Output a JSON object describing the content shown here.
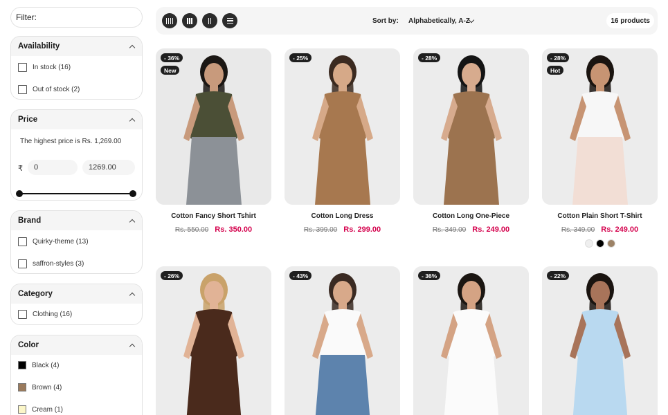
{
  "sidebar": {
    "filter_label": "Filter:",
    "availability": {
      "title": "Availability",
      "options": [
        {
          "label": "In stock (16)"
        },
        {
          "label": "Out of stock (2)"
        }
      ]
    },
    "price": {
      "title": "Price",
      "note": "The highest price is Rs. 1,269.00",
      "currency": "₹",
      "min": "0",
      "max": "1269.00"
    },
    "brand": {
      "title": "Brand",
      "options": [
        {
          "label": "Quirky-theme (13)"
        },
        {
          "label": "saffron-styles (3)"
        }
      ]
    },
    "category": {
      "title": "Category",
      "options": [
        {
          "label": "Clothing (16)"
        }
      ]
    },
    "color": {
      "title": "Color",
      "options": [
        {
          "label": "Black (4)",
          "swatch": "#000000"
        },
        {
          "label": "Brown (4)",
          "swatch": "#9a7a5c"
        },
        {
          "label": "Cream (1)",
          "swatch": "#fbf6c8"
        }
      ]
    }
  },
  "toolbar": {
    "views": [
      "grid-4-icon",
      "grid-3-icon",
      "grid-2-icon",
      "list-icon"
    ],
    "sort_label": "Sort by:",
    "sort_value": "Alphabetically, A-Z",
    "count": "16 products"
  },
  "products": [
    {
      "name": "Cotton Fancy Short Tshirt",
      "old": "Rs. 550.00",
      "new": "Rs. 350.00",
      "badges": [
        "- 36%",
        "New"
      ],
      "bg": "#e9e9e9",
      "top": "#4b4f36",
      "bottom": "#8c9197",
      "skin": "#c89a7c",
      "hair": "#1b1714"
    },
    {
      "name": "Cotton Long Dress",
      "old": "Rs. 399.00",
      "new": "Rs. 299.00",
      "badges": [
        "- 25%"
      ],
      "bg": "#ececec",
      "top": "#a7784f",
      "bottom": "#a7784f",
      "skin": "#d6a988",
      "hair": "#3b2a20"
    },
    {
      "name": "Cotton Long One-Piece",
      "old": "Rs. 349.00",
      "new": "Rs. 249.00",
      "badges": [
        "- 28%"
      ],
      "bg": "#ececec",
      "top": "#9c734f",
      "bottom": "#9c734f",
      "skin": "#d7ab8e",
      "hair": "#141414"
    },
    {
      "name": "Cotton Plain Short T-Shirt",
      "old": "Rs. 349.00",
      "new": "Rs. 249.00",
      "badges": [
        "- 28%",
        "Hot"
      ],
      "bg": "#ececec",
      "top": "#f7f7f7",
      "bottom": "#f2ded5",
      "skin": "#c79473",
      "hair": "#1a1410",
      "colors": [
        "#efefef",
        "#000000",
        "#9c8266"
      ]
    },
    {
      "name": "",
      "badges": [
        "- 26%"
      ],
      "bg": "#ececec",
      "top": "#4a2a1c",
      "bottom": "#4a2a1c",
      "skin": "#e1b396",
      "hair": "#c9a26a"
    },
    {
      "name": "",
      "badges": [
        "- 43%"
      ],
      "bg": "#ececec",
      "top": "#fafafa",
      "bottom": "#5d83ad",
      "skin": "#d8a98a",
      "hair": "#3a2a22"
    },
    {
      "name": "",
      "badges": [
        "- 36%"
      ],
      "bg": "#ececec",
      "top": "#fbfbfb",
      "bottom": "#fbfbfb",
      "skin": "#d4a384",
      "hair": "#1b1612"
    },
    {
      "name": "",
      "badges": [
        "- 22%"
      ],
      "bg": "#ececec",
      "top": "#b9d9f0",
      "bottom": "#b9d9f0",
      "skin": "#a8745a",
      "hair": "#1a1410"
    }
  ]
}
